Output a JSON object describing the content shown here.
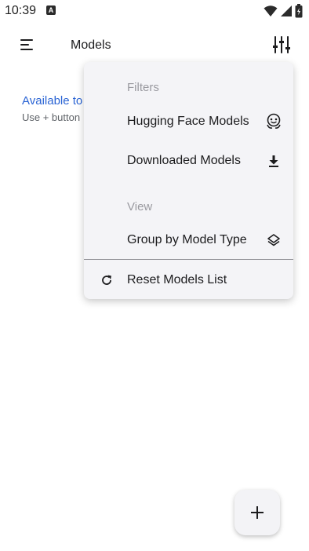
{
  "status_bar": {
    "time": "10:39",
    "notification_letter": "A"
  },
  "app_bar": {
    "title": "Models"
  },
  "empty_state": {
    "title": "Available to",
    "subtitle": "Use + button"
  },
  "menu": {
    "filters_header": "Filters",
    "items": [
      {
        "label": "Hugging Face Models",
        "icon": "hugging-face-icon"
      },
      {
        "label": "Downloaded Models",
        "icon": "download-icon"
      }
    ],
    "view_header": "View",
    "view_items": [
      {
        "label": "Group by Model Type",
        "icon": "layers-icon"
      }
    ],
    "reset_label": "Reset Models List",
    "reset_icon": "refresh-icon"
  },
  "fab": {
    "icon": "plus-icon"
  },
  "colors": {
    "accent": "#2a64d4",
    "menu_bg": "#f4f4f7",
    "header_gray": "#9a9aa0"
  }
}
